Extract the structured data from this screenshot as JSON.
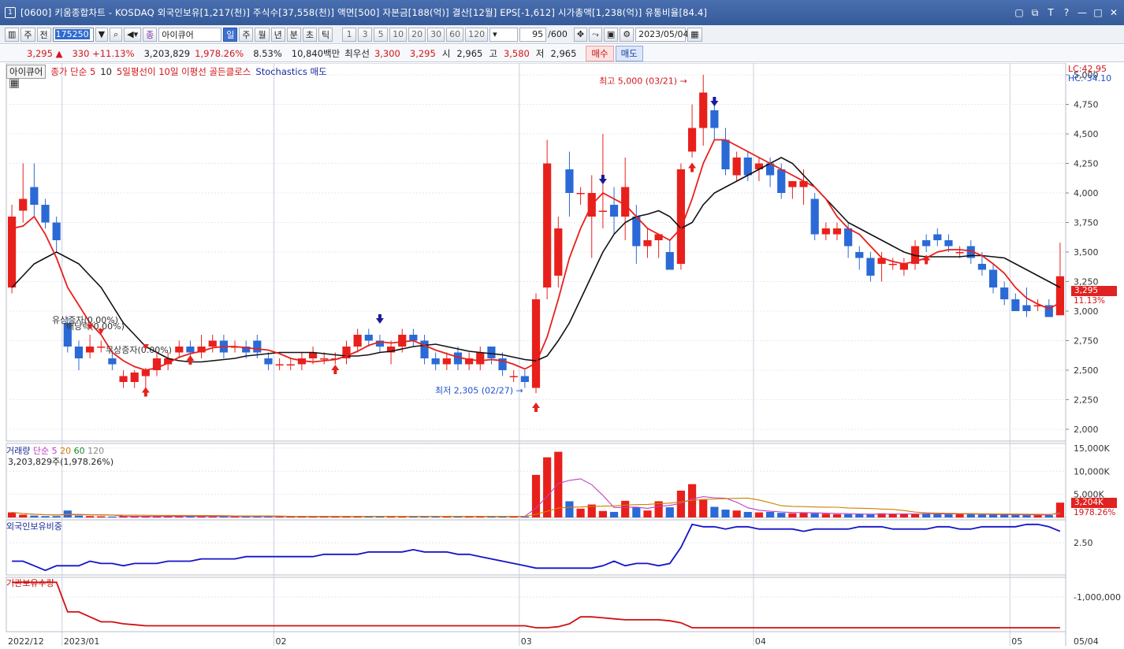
{
  "window": {
    "title": "[0600] 키움종합차트 - KOSDAQ 외국인보유[1,217(천)] 주식수[37,558(천)] 액면[500] 자본금[188(억)] 결산[12월] EPS[-1,612] 시가총액[1,238(억)] 유통비율[84.4]",
    "controls": [
      "▢",
      "⧉",
      "T",
      "?",
      "—",
      "□",
      "✕"
    ]
  },
  "toolbar": {
    "period_main": "주",
    "period_prev": "전",
    "stock_code": "175250",
    "indicator": "아이큐어",
    "tabs": [
      "일",
      "주",
      "월",
      "년",
      "분",
      "초",
      "틱"
    ],
    "active_tab": "일",
    "numbers": [
      "1",
      "3",
      "5",
      "10",
      "20",
      "30",
      "60",
      "120"
    ],
    "count": "95",
    "count_total": "/600",
    "date": "2023/05/04"
  },
  "quote": {
    "price": "3,295",
    "arrow": "▲",
    "change": "330",
    "change_pct": "+11.13%",
    "volume": "3,203,829",
    "volume_pct": "1,978.26%",
    "turnover": "8.53%",
    "amount": "10,840백만",
    "best_label": "최우선",
    "best_ask": "3,300",
    "best_bid": "3,295",
    "open_label": "시",
    "open": "2,965",
    "high_label": "고",
    "high": "3,580",
    "low_label": "저",
    "low": "2,965",
    "buy": "매수",
    "sell": "매도"
  },
  "legend": {
    "stock": "아이큐어",
    "ma": "종가 단순 5",
    "ma2": "10",
    "signal": "5일평선이 10일 이평선 골든클로스",
    "stoch": "Stochastics 매도"
  },
  "corner": {
    "lc": "LC:42.95",
    "hc": "HC:-34.10"
  },
  "annotations": {
    "high": "최고 5,000 (03/21)",
    "low": "최저 2,305 (02/27)",
    "rights1": "유상증자(0.00%)",
    "dividend": "배당락(0.00%)",
    "rights2": "무상증자(0.00%)"
  },
  "price_axis": [
    "5,000",
    "4,750",
    "4,500",
    "4,250",
    "4,000",
    "3,750",
    "3,500",
    "3,250",
    "3,000",
    "2,750",
    "2,500",
    "2,250",
    "2,000"
  ],
  "current_tag": {
    "price": "3,295",
    "pct": "11.13%"
  },
  "volume_panel": {
    "title": "거래량",
    "ma": "단순 5",
    "ma20": "20",
    "ma60": "60",
    "ma120": "120",
    "info": "3,203,829주(1,978.26%)",
    "axis": [
      "15,000K",
      "10,000K",
      "5,000K"
    ],
    "tag": "3,204K",
    "tag_pct": "1978.26%"
  },
  "foreign_panel": {
    "title": "외국인보유비중",
    "axis": [
      "2.50"
    ]
  },
  "inst_panel": {
    "title": "기관보유수량",
    "axis": [
      "-1,000,000"
    ]
  },
  "date_axis": [
    "2022/12",
    "2023/01",
    "02",
    "03",
    "04",
    "05",
    "05/04"
  ],
  "colors": {
    "up": "#e8201c",
    "down": "#2b6ad6",
    "ma5": "#e8201c",
    "ma10": "#111111",
    "foreign": "#1414c8",
    "inst": "#d01010"
  },
  "chart_data": {
    "type": "candlestick",
    "candles": [
      [
        3200,
        3800,
        3150,
        3900
      ],
      [
        3850,
        3950,
        3750,
        4250
      ],
      [
        4050,
        3900,
        3800,
        4250
      ],
      [
        3900,
        3750,
        3700,
        3950
      ],
      [
        3750,
        3600,
        3500,
        3800
      ],
      [
        2900,
        2700,
        2650,
        2950
      ],
      [
        2700,
        2600,
        2500,
        2750
      ],
      [
        2650,
        2700,
        2600,
        2800
      ],
      [
        2700,
        2700,
        2650,
        2750
      ],
      [
        2600,
        2550,
        2500,
        2650
      ],
      [
        2400,
        2450,
        2350,
        2500
      ],
      [
        2400,
        2480,
        2350,
        2500
      ],
      [
        2450,
        2500,
        2350,
        2520
      ],
      [
        2500,
        2600,
        2450,
        2650
      ],
      [
        2550,
        2600,
        2500,
        2650
      ],
      [
        2650,
        2700,
        2600,
        2750
      ],
      [
        2700,
        2650,
        2600,
        2750
      ],
      [
        2650,
        2700,
        2600,
        2800
      ],
      [
        2700,
        2750,
        2650,
        2800
      ],
      [
        2750,
        2650,
        2600,
        2800
      ],
      [
        2700,
        2700,
        2650,
        2750
      ],
      [
        2700,
        2650,
        2600,
        2750
      ],
      [
        2750,
        2650,
        2600,
        2800
      ],
      [
        2600,
        2550,
        2500,
        2650
      ],
      [
        2550,
        2550,
        2500,
        2600
      ],
      [
        2550,
        2550,
        2500,
        2600
      ],
      [
        2550,
        2600,
        2500,
        2650
      ],
      [
        2600,
        2650,
        2550,
        2700
      ],
      [
        2600,
        2600,
        2550,
        2650
      ],
      [
        2600,
        2600,
        2550,
        2650
      ],
      [
        2600,
        2700,
        2550,
        2750
      ],
      [
        2700,
        2800,
        2650,
        2850
      ],
      [
        2800,
        2750,
        2700,
        2850
      ],
      [
        2750,
        2700,
        2650,
        2800
      ],
      [
        2650,
        2700,
        2550,
        2750
      ],
      [
        2700,
        2800,
        2650,
        2850
      ],
      [
        2800,
        2750,
        2700,
        2850
      ],
      [
        2750,
        2600,
        2550,
        2800
      ],
      [
        2600,
        2550,
        2500,
        2650
      ],
      [
        2550,
        2600,
        2500,
        2650
      ],
      [
        2650,
        2550,
        2500,
        2700
      ],
      [
        2550,
        2600,
        2500,
        2650
      ],
      [
        2550,
        2650,
        2500,
        2700
      ],
      [
        2700,
        2600,
        2550,
        2700
      ],
      [
        2600,
        2500,
        2450,
        2650
      ],
      [
        2450,
        2450,
        2400,
        2500
      ],
      [
        2450,
        2400,
        2350,
        2500
      ],
      [
        2350,
        3100,
        2305,
        3150
      ],
      [
        3200,
        4250,
        3100,
        4450
      ],
      [
        3300,
        3700,
        3200,
        3800
      ],
      [
        4200,
        4000,
        3800,
        4350
      ],
      [
        4000,
        4000,
        3900,
        4050
      ],
      [
        3800,
        4000,
        3450,
        4150
      ],
      [
        3850,
        3850,
        3700,
        4500
      ],
      [
        3900,
        3800,
        3650,
        4050
      ],
      [
        3800,
        4050,
        3600,
        4300
      ],
      [
        3800,
        3550,
        3400,
        3900
      ],
      [
        3550,
        3600,
        3450,
        3700
      ],
      [
        3600,
        3650,
        3450,
        3650
      ],
      [
        3500,
        3350,
        3400,
        3600
      ],
      [
        3400,
        4200,
        3350,
        4250
      ],
      [
        4350,
        4550,
        4300,
        4750
      ],
      [
        4550,
        4850,
        4400,
        5000
      ],
      [
        4700,
        4550,
        4450,
        4800
      ],
      [
        4450,
        4200,
        4150,
        4550
      ],
      [
        4150,
        4300,
        4100,
        4350
      ],
      [
        4300,
        4150,
        4100,
        4350
      ],
      [
        4200,
        4250,
        4100,
        4300
      ],
      [
        4250,
        4150,
        4050,
        4300
      ],
      [
        4200,
        4000,
        3950,
        4250
      ],
      [
        4050,
        4100,
        3950,
        4100
      ],
      [
        4050,
        4100,
        3900,
        4200
      ],
      [
        3950,
        3650,
        3600,
        4000
      ],
      [
        3650,
        3700,
        3600,
        3750
      ],
      [
        3650,
        3700,
        3600,
        3750
      ],
      [
        3700,
        3550,
        3450,
        3750
      ],
      [
        3500,
        3450,
        3350,
        3550
      ],
      [
        3450,
        3300,
        3250,
        3500
      ],
      [
        3400,
        3450,
        3250,
        3500
      ],
      [
        3400,
        3400,
        3350,
        3450
      ],
      [
        3350,
        3400,
        3300,
        3450
      ],
      [
        3400,
        3550,
        3350,
        3600
      ],
      [
        3600,
        3550,
        3500,
        3650
      ],
      [
        3650,
        3600,
        3550,
        3700
      ],
      [
        3600,
        3550,
        3500,
        3650
      ],
      [
        3500,
        3500,
        3450,
        3550
      ],
      [
        3550,
        3450,
        3400,
        3600
      ],
      [
        3400,
        3350,
        3300,
        3500
      ],
      [
        3350,
        3200,
        3150,
        3400
      ],
      [
        3200,
        3100,
        3050,
        3250
      ],
      [
        3100,
        3000,
        3000,
        3150
      ],
      [
        3050,
        3000,
        2950,
        3200
      ],
      [
        3050,
        3050,
        3000,
        3100
      ],
      [
        3050,
        2950,
        2950,
        3100
      ],
      [
        2965,
        3295,
        2965,
        3580
      ]
    ],
    "ma5": [
      3700,
      3720,
      3800,
      3650,
      3450,
      3200,
      3050,
      2900,
      2800,
      2650,
      2580,
      2530,
      2500,
      2520,
      2560,
      2610,
      2640,
      2660,
      2690,
      2700,
      2700,
      2690,
      2680,
      2670,
      2640,
      2600,
      2580,
      2570,
      2580,
      2590,
      2620,
      2660,
      2710,
      2740,
      2730,
      2740,
      2750,
      2710,
      2670,
      2640,
      2610,
      2590,
      2580,
      2590,
      2580,
      2550,
      2510,
      2560,
      2780,
      3100,
      3450,
      3700,
      3900,
      4000,
      3950,
      3900,
      3800,
      3700,
      3650,
      3600,
      3700,
      3950,
      4250,
      4450,
      4450,
      4400,
      4350,
      4300,
      4250,
      4200,
      4150,
      4100,
      4050,
      3950,
      3800,
      3700,
      3650,
      3550,
      3450,
      3420,
      3400,
      3420,
      3450,
      3500,
      3520,
      3520,
      3510,
      3470,
      3400,
      3320,
      3200,
      3110,
      3060,
      3020,
      3070
    ],
    "ma10": [
      3200,
      3300,
      3400,
      3450,
      3500,
      3450,
      3400,
      3300,
      3200,
      3050,
      2900,
      2800,
      2700,
      2650,
      2600,
      2580,
      2570,
      2570,
      2580,
      2590,
      2600,
      2620,
      2630,
      2640,
      2650,
      2650,
      2650,
      2650,
      2640,
      2630,
      2620,
      2620,
      2630,
      2650,
      2660,
      2680,
      2700,
      2710,
      2720,
      2700,
      2680,
      2660,
      2650,
      2640,
      2630,
      2610,
      2590,
      2580,
      2620,
      2750,
      2900,
      3100,
      3300,
      3500,
      3650,
      3750,
      3800,
      3820,
      3850,
      3800,
      3700,
      3750,
      3900,
      4000,
      4050,
      4100,
      4150,
      4200,
      4250,
      4300,
      4250,
      4150,
      4050,
      3950,
      3850,
      3750,
      3700,
      3650,
      3600,
      3550,
      3500,
      3470,
      3460,
      3460,
      3460,
      3460,
      3470,
      3470,
      3460,
      3450,
      3400,
      3350,
      3300,
      3250,
      3200
    ],
    "volume": [
      1100,
      600,
      400,
      300,
      300,
      1500,
      400,
      300,
      250,
      200,
      300,
      250,
      250,
      300,
      250,
      250,
      200,
      250,
      250,
      200,
      200,
      250,
      250,
      200,
      200,
      200,
      250,
      250,
      200,
      200,
      250,
      300,
      250,
      250,
      200,
      250,
      250,
      300,
      250,
      200,
      200,
      250,
      250,
      250,
      250,
      200,
      200,
      9200,
      13000,
      14200,
      3500,
      1900,
      2800,
      1400,
      1200,
      3600,
      2200,
      1500,
      3500,
      2200,
      5800,
      7200,
      3800,
      2300,
      1700,
      1500,
      1200,
      1100,
      1200,
      1000,
      900,
      1000,
      900,
      800,
      700,
      700,
      700,
      700,
      900,
      800,
      700,
      700,
      900,
      800,
      700,
      700,
      700,
      600,
      600,
      600,
      600,
      500,
      500,
      500,
      3204
    ],
    "foreign_ratio": [
      2.1,
      2.1,
      2.0,
      1.9,
      2.0,
      2.0,
      2.0,
      2.1,
      2.05,
      2.05,
      2.0,
      2.05,
      2.05,
      2.05,
      2.1,
      2.1,
      2.1,
      2.15,
      2.15,
      2.15,
      2.15,
      2.2,
      2.2,
      2.2,
      2.2,
      2.2,
      2.2,
      2.2,
      2.25,
      2.25,
      2.25,
      2.25,
      2.3,
      2.3,
      2.3,
      2.3,
      2.35,
      2.3,
      2.3,
      2.3,
      2.25,
      2.25,
      2.2,
      2.15,
      2.1,
      2.05,
      2.0,
      1.95,
      1.95,
      1.95,
      1.95,
      1.95,
      1.95,
      2.0,
      2.1,
      2.0,
      2.05,
      2.05,
      2.0,
      2.05,
      2.4,
      2.9,
      2.85,
      2.85,
      2.8,
      2.85,
      2.85,
      2.8,
      2.8,
      2.8,
      2.8,
      2.75,
      2.8,
      2.8,
      2.8,
      2.8,
      2.85,
      2.85,
      2.85,
      2.8,
      2.8,
      2.8,
      2.8,
      2.85,
      2.85,
      2.8,
      2.8,
      2.85,
      2.85,
      2.85,
      2.85,
      2.9,
      2.9,
      2.85,
      2.75
    ],
    "inst_holdings": [
      -850000,
      -850000,
      -850000,
      -850000,
      -850000,
      -1150000,
      -1150000,
      -1200000,
      -1250000,
      -1250000,
      -1270000,
      -1280000,
      -1290000,
      -1290000,
      -1290000,
      -1290000,
      -1290000,
      -1290000,
      -1290000,
      -1290000,
      -1290000,
      -1290000,
      -1290000,
      -1290000,
      -1290000,
      -1290000,
      -1290000,
      -1290000,
      -1290000,
      -1290000,
      -1290000,
      -1290000,
      -1290000,
      -1290000,
      -1290000,
      -1290000,
      -1290000,
      -1290000,
      -1290000,
      -1290000,
      -1290000,
      -1290000,
      -1290000,
      -1290000,
      -1290000,
      -1290000,
      -1290000,
      -1310000,
      -1310000,
      -1300000,
      -1270000,
      -1200000,
      -1200000,
      -1210000,
      -1220000,
      -1230000,
      -1230000,
      -1230000,
      -1230000,
      -1240000,
      -1260000,
      -1310000,
      -1310000,
      -1310000,
      -1310000,
      -1310000,
      -1310000,
      -1310000,
      -1310000,
      -1310000,
      -1310000,
      -1310000,
      -1310000,
      -1310000,
      -1310000,
      -1310000,
      -1310000,
      -1310000,
      -1310000,
      -1310000,
      -1310000,
      -1310000,
      -1310000,
      -1310000,
      -1310000,
      -1310000,
      -1310000,
      -1310000,
      -1310000,
      -1310000,
      -1310000,
      -1310000,
      -1310000,
      -1310000,
      -1310000
    ],
    "price_range": [
      1900,
      5100
    ],
    "volume_range": [
      0,
      16000
    ],
    "foreign_range": [
      1.8,
      3.0
    ],
    "inst_range": [
      -1350000,
      -800000
    ]
  }
}
